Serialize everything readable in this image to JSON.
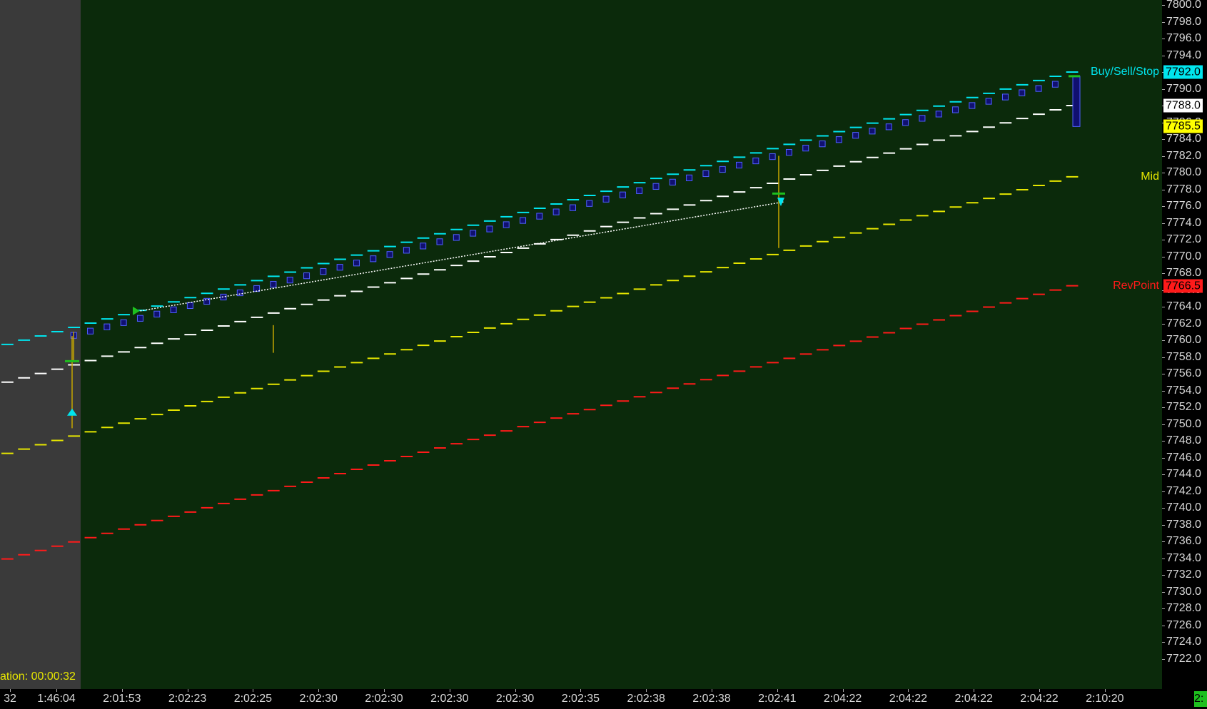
{
  "chart_data": {
    "type": "line",
    "ylim": [
      7720.0,
      7800.0
    ],
    "y_ticks": [
      "7800.0",
      "7798.0",
      "7796.0",
      "7794.0",
      "7792.0",
      "7790.0",
      "7788.0",
      "7786.0",
      "7784.0",
      "7782.0",
      "7780.0",
      "7778.0",
      "7776.0",
      "7774.0",
      "7772.0",
      "7770.0",
      "7768.0",
      "7766.0",
      "7764.0",
      "7762.0",
      "7760.0",
      "7758.0",
      "7756.0",
      "7754.0",
      "7752.0",
      "7750.0",
      "7748.0",
      "7746.0",
      "7744.0",
      "7742.0",
      "7740.0",
      "7738.0",
      "7736.0",
      "7734.0",
      "7732.0",
      "7730.0",
      "7728.0",
      "7726.0",
      "7724.0",
      "7722.0"
    ],
    "x_tick_labels": [
      "32",
      "1:46:04",
      "2:01:53",
      "2:02:23",
      "2:02:25",
      "2:02:30",
      "2:02:30",
      "2:02:30",
      "2:02:30",
      "2:02:35",
      "2:02:38",
      "2:02:38",
      "2:02:41",
      "2:04:22",
      "2:04:22",
      "2:04:22",
      "2:04:22",
      "2:10:20"
    ],
    "series": [
      {
        "name": "Buy/Sell/Stop",
        "color": "#00e5ee",
        "start": 7759.5,
        "end": 7792.0
      },
      {
        "name": "",
        "color": "#ffffff",
        "start": 7755.0,
        "end": 7788.0
      },
      {
        "name": "Mid",
        "color": "#e6e600",
        "start": 7746.5,
        "end": 7779.5
      },
      {
        "name": "RevPoint",
        "color": "#ff1a1a",
        "start": 7733.9,
        "end": 7766.5
      }
    ],
    "markers": [
      {
        "kind": "buy-arrow",
        "color": "#00e5ee",
        "price": 7751.0
      },
      {
        "kind": "flag",
        "color": "#1ec01e",
        "price": 7763.5
      },
      {
        "kind": "sell-arrow",
        "color": "#00e5ee",
        "price": 7776.5
      }
    ],
    "price_boxes": [
      {
        "text": "7792.0",
        "value": 7792.0,
        "bg": "#00e5ee",
        "fg": "#000000"
      },
      {
        "text": "7788.0",
        "value": 7788.0,
        "bg": "#ffffff",
        "fg": "#000000"
      },
      {
        "text": "7785.5",
        "value": 7785.5,
        "bg": "#ffff00",
        "fg": "#000000"
      },
      {
        "text": "7766.5",
        "value": 7766.5,
        "bg": "#ff1a1a",
        "fg": "#000000"
      }
    ],
    "line_labels": [
      {
        "text": "Buy/Sell/Stop",
        "value": 7792.0,
        "color": "#00e5ee"
      },
      {
        "text": "Mid",
        "value": 7779.5,
        "color": "#e6e600"
      },
      {
        "text": "RevPoint",
        "value": 7766.5,
        "color": "#ff1a1a"
      }
    ],
    "duration_text": "ation: 00:00:32",
    "corner_text": "2:"
  }
}
